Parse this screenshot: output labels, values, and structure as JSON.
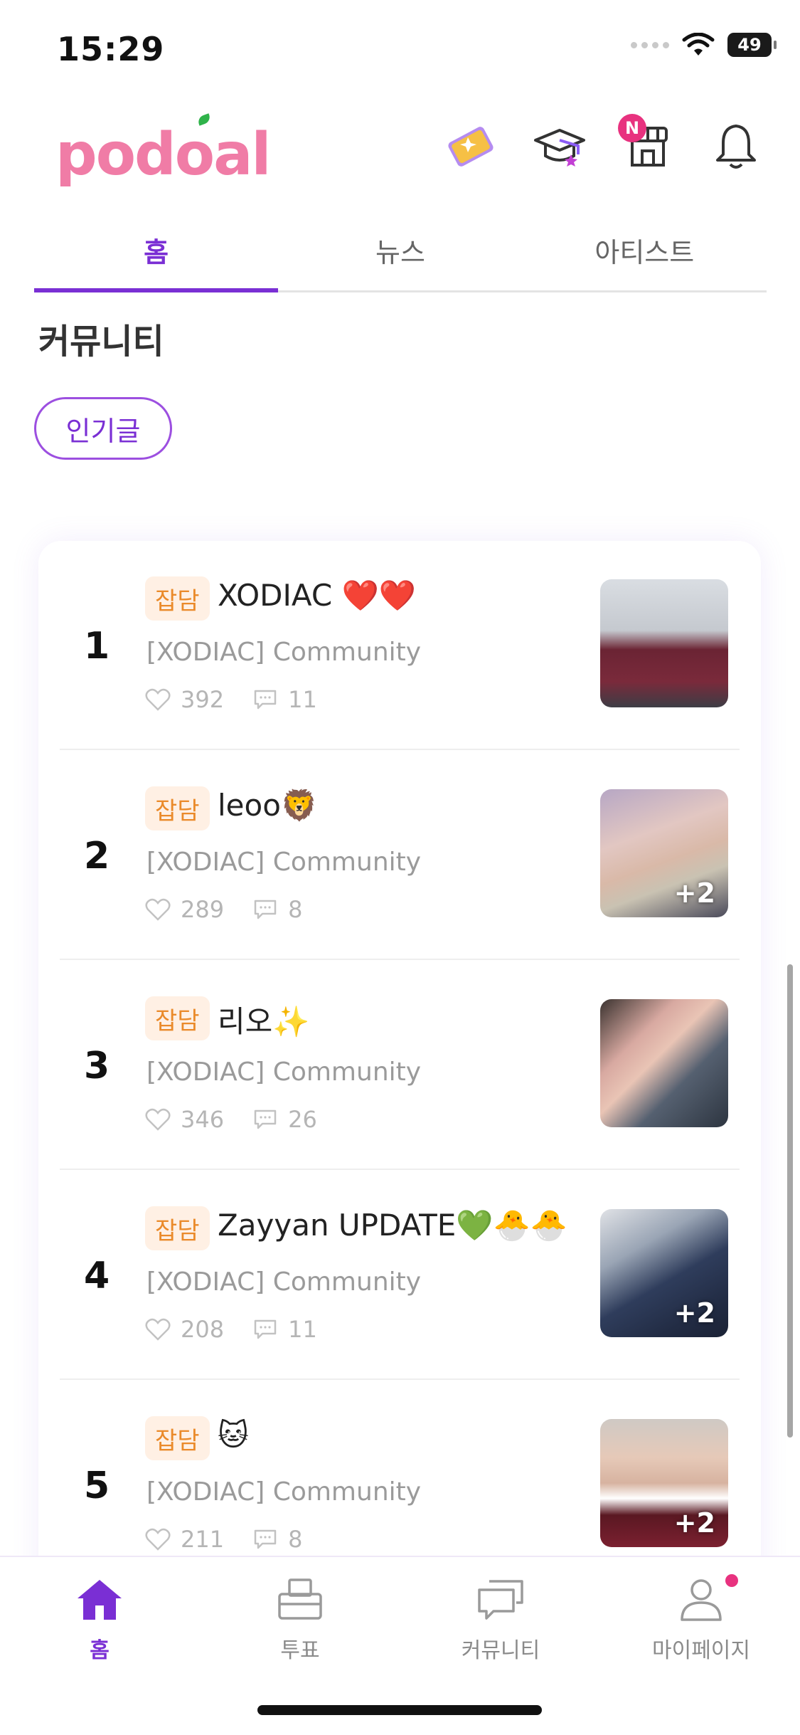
{
  "status": {
    "time": "15:29",
    "battery": "49"
  },
  "header": {
    "logo": "podoal",
    "notice_badge": "N"
  },
  "tabs": [
    {
      "label": "홈",
      "active": true
    },
    {
      "label": "뉴스",
      "active": false
    },
    {
      "label": "아티스트",
      "active": false
    }
  ],
  "section": {
    "title": "커뮤니티",
    "chip": "인기글"
  },
  "posts": [
    {
      "rank": "1",
      "tag": "잡담",
      "title": "XODIAC ❤️❤️",
      "community": "[XODIAC] Community",
      "likes": "392",
      "comments": "11",
      "extra_images": ""
    },
    {
      "rank": "2",
      "tag": "잡담",
      "title": "leoo🦁",
      "community": "[XODIAC] Community",
      "likes": "289",
      "comments": "8",
      "extra_images": "+2"
    },
    {
      "rank": "3",
      "tag": "잡담",
      "title": "리오✨",
      "community": "[XODIAC] Community",
      "likes": "346",
      "comments": "26",
      "extra_images": ""
    },
    {
      "rank": "4",
      "tag": "잡담",
      "title": "Zayyan UPDATE💚🐣🐣",
      "community": "[XODIAC] Community",
      "likes": "208",
      "comments": "11",
      "extra_images": "+2"
    },
    {
      "rank": "5",
      "tag": "잡담",
      "title": "🐱",
      "community": "[XODIAC] Community",
      "likes": "211",
      "comments": "8",
      "extra_images": "+2"
    }
  ],
  "bottom_nav": [
    {
      "label": "홈",
      "icon": "home-icon",
      "active": true
    },
    {
      "label": "투표",
      "icon": "ballot-box-icon",
      "active": false
    },
    {
      "label": "커뮤니티",
      "icon": "chat-bubbles-icon",
      "active": false
    },
    {
      "label": "마이페이지",
      "icon": "user-icon",
      "active": false
    }
  ],
  "colors": {
    "accent": "#7a2fd4",
    "logo": "#f07ca6",
    "tag_bg": "#fff0e4",
    "tag_text": "#ea8a2a",
    "badge": "#e8327f"
  }
}
